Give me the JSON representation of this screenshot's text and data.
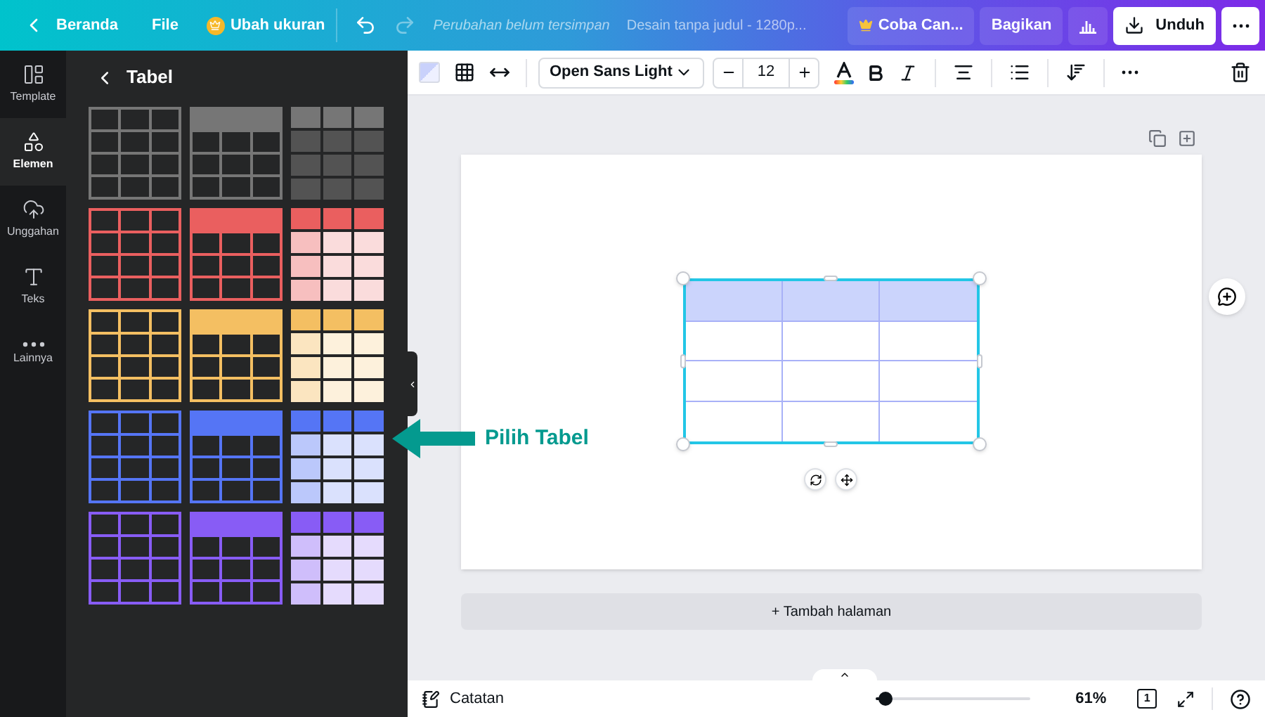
{
  "topbar": {
    "back_label": "Beranda",
    "file": "File",
    "resize": "Ubah ukuran",
    "redo_disabled": true,
    "save_status": "Perubahan belum tersimpan",
    "doc_title": "Desain tanpa judul - 1280p...",
    "try_pro": "Coba Can...",
    "share": "Bagikan",
    "download": "Unduh"
  },
  "rail": [
    {
      "label": "Template",
      "selected": false
    },
    {
      "label": "Elemen",
      "selected": true
    },
    {
      "label": "Unggahan",
      "selected": false
    },
    {
      "label": "Teks",
      "selected": false
    },
    {
      "label": "Lainnya",
      "selected": false
    }
  ],
  "panel": {
    "title": "Tabel",
    "palettes": [
      {
        "kind": "neutral",
        "color": "#767676"
      },
      {
        "kind": "colored",
        "color": "#ea5f5f"
      },
      {
        "kind": "colored",
        "color": "#f4bf62"
      },
      {
        "kind": "colored",
        "color": "#5575f5"
      },
      {
        "kind": "colored",
        "color": "#885cf5"
      }
    ]
  },
  "toolbar": {
    "font": "Open Sans Light",
    "font_size": "12"
  },
  "annotation": {
    "label": "Pilih Tabel"
  },
  "add_page": "+ Tambah halaman",
  "bottom": {
    "notes": "Catatan",
    "zoom": {
      "level": 0.07
    },
    "zoom_label": "61%",
    "page_count": "1"
  }
}
